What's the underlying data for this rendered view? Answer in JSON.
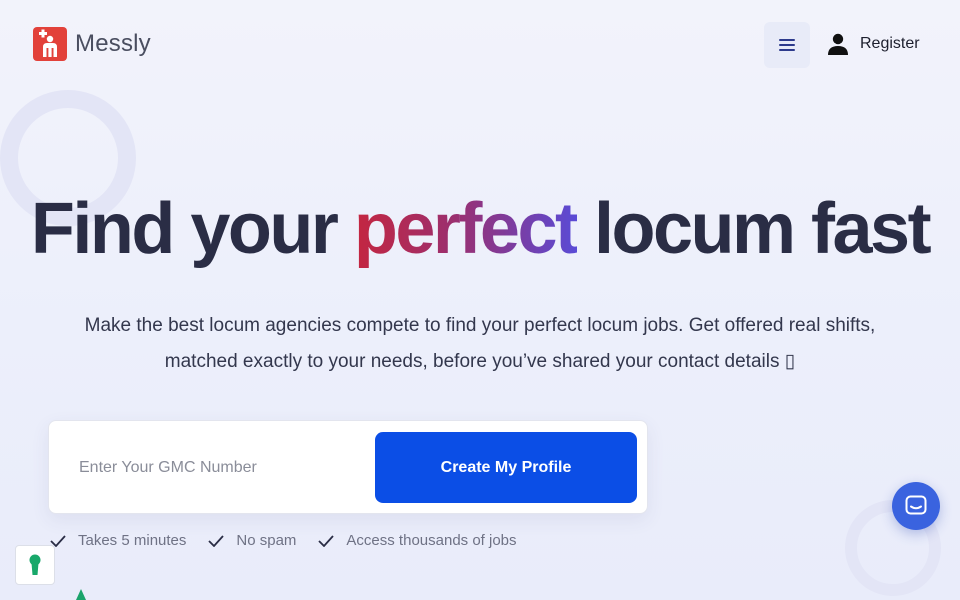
{
  "header": {
    "logo_text": "Messly",
    "logo_icon": "doctor-cross-icon",
    "menu_icon": "hamburger-icon",
    "register_label": "Register",
    "register_icon": "user-icon"
  },
  "hero": {
    "headline_before": "Find your ",
    "headline_accent": "perfect",
    "headline_after": " locum fast",
    "subtitle_line1": "Make the best locum agencies compete to find your perfect locum jobs. Get offered real shifts,",
    "subtitle_line2": "matched exactly to your needs, before you’ve shared your contact details ▯"
  },
  "form": {
    "gmc_placeholder": "Enter Your GMC Number",
    "gmc_value": "",
    "submit_label": "Create My Profile"
  },
  "features": [
    {
      "label": "Takes 5 minutes",
      "icon": "check-icon"
    },
    {
      "label": "No spam",
      "icon": "check-icon"
    },
    {
      "label": "Access thousands of jobs",
      "icon": "check-icon"
    }
  ],
  "widgets": {
    "cookie_icon": "keyhole-icon",
    "chat_icon": "chat-bubble-icon"
  },
  "colors": {
    "primary": "#0b4ee6",
    "logo_red": "#e2413a",
    "accent_start": "#c42640",
    "accent_end": "#5a4bd6",
    "chat_blue": "#3a63df"
  }
}
